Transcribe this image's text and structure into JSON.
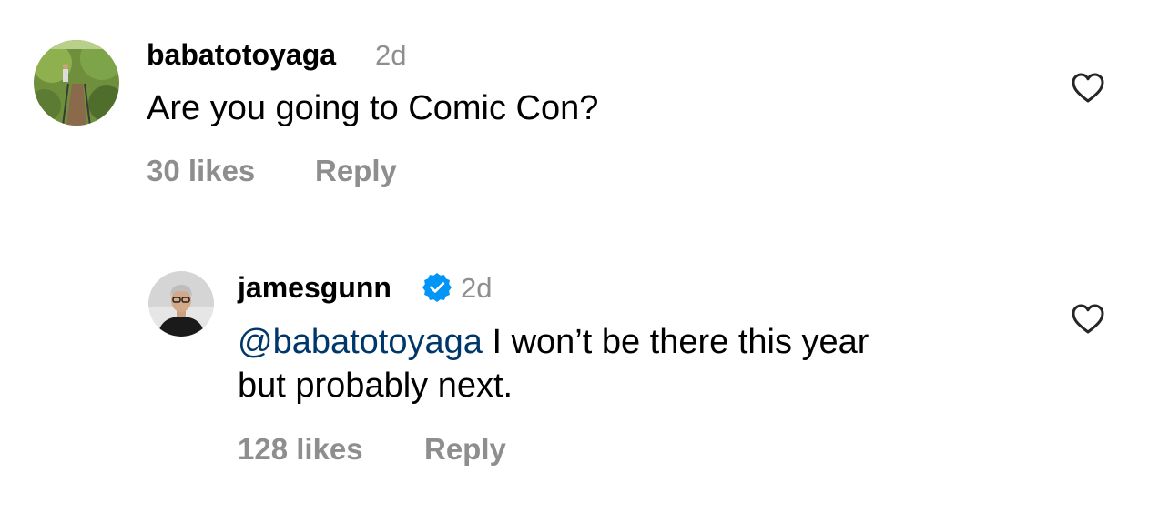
{
  "comments": [
    {
      "username": "babatotoyaga",
      "time": "2d",
      "text": "Are you going to Comic Con?",
      "likes": "30 likes",
      "reply_label": "Reply",
      "verified": false
    },
    {
      "username": "jamesgunn",
      "time": "2d",
      "mention": "@babatotoyaga",
      "text_line1": " I won’t be there this year",
      "text_line2": "but probably next.",
      "likes": "128 likes",
      "reply_label": "Reply",
      "verified": true
    }
  ],
  "colors": {
    "secondary_text": "#8e8e8e",
    "mention": "#00376b",
    "verified_badge": "#0095f6"
  },
  "icons": {
    "like": "heart-outline-icon",
    "verified": "verified-badge-icon"
  }
}
